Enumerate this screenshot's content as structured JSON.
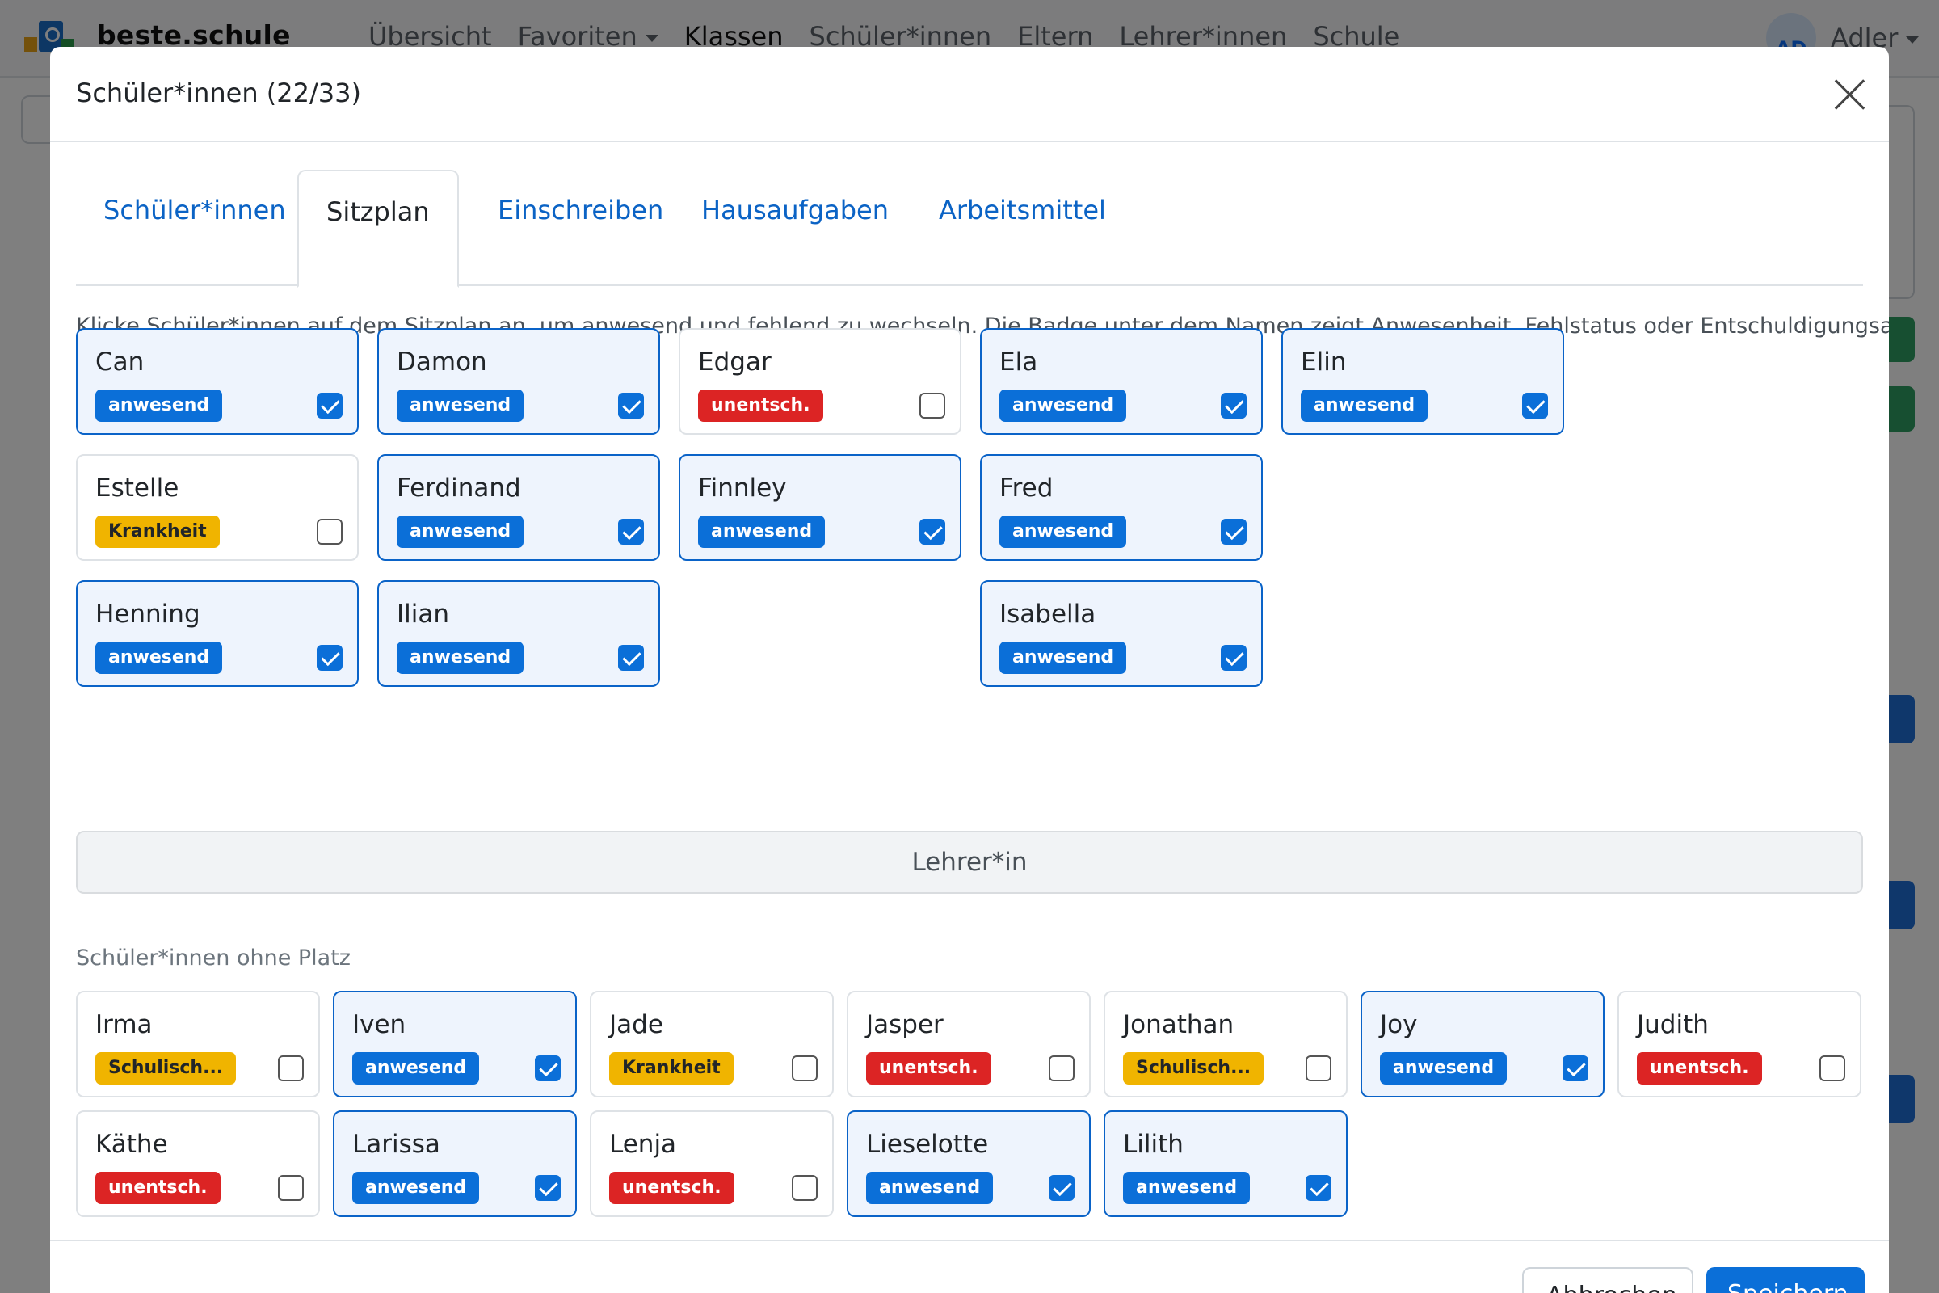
{
  "navbar": {
    "brand": "beste.schule",
    "links": [
      "Übersicht",
      "Favoriten",
      "Klassen",
      "Schüler*innen",
      "Eltern",
      "Lehrer*innen",
      "Schule"
    ],
    "user_initials": "AD",
    "user_name": "Adler"
  },
  "modal": {
    "title": "Schüler*innen (22/33)",
    "tabs": [
      "Schüler*innen",
      "Sitzplan",
      "Einschreiben",
      "Hausaufgaben",
      "Arbeitsmittel"
    ],
    "active_tab": "Sitzplan",
    "hint": "Klicke Schüler*innen auf dem Sitzplan an, um anwesend und fehlend zu wechseln. Die Badge unter dem Namen zeigt Anwesenheit, Fehlstatus oder Entschuldigungsart.",
    "seated": [
      {
        "name": "Can",
        "badge": "anwesend",
        "status": "present",
        "checked": true
      },
      {
        "name": "Damon",
        "badge": "anwesend",
        "status": "present",
        "checked": true
      },
      {
        "name": "Edgar",
        "badge": "unentsch.",
        "status": "absent",
        "checked": false
      },
      {
        "name": "Ela",
        "badge": "anwesend",
        "status": "present",
        "checked": true
      },
      {
        "name": "Elin",
        "badge": "anwesend",
        "status": "present",
        "checked": true
      },
      {
        "name": "Estelle",
        "badge": "Krankheit",
        "status": "sick",
        "checked": false
      },
      {
        "name": "Ferdinand",
        "badge": "anwesend",
        "status": "present",
        "checked": true
      },
      {
        "name": "Finnley",
        "badge": "anwesend",
        "status": "present",
        "checked": true
      },
      {
        "name": "Fred",
        "badge": "anwesend",
        "status": "present",
        "checked": true
      },
      {
        "name": "Henning",
        "badge": "anwesend",
        "status": "present",
        "checked": true
      },
      {
        "name": "Ilian",
        "badge": "anwesend",
        "status": "present",
        "checked": true
      },
      {
        "name": "Isabella",
        "badge": "anwesend",
        "status": "present",
        "checked": true
      }
    ],
    "teacher_label": "Lehrer*in",
    "unseated_title": "Schüler*innen ohne Platz",
    "unseated": [
      {
        "name": "Irma",
        "badge": "Schulisch...",
        "status": "school",
        "checked": false
      },
      {
        "name": "Iven",
        "badge": "anwesend",
        "status": "present",
        "checked": true
      },
      {
        "name": "Jade",
        "badge": "Krankheit",
        "status": "sick",
        "checked": false
      },
      {
        "name": "Jasper",
        "badge": "unentsch.",
        "status": "absent",
        "checked": false
      },
      {
        "name": "Jonathan",
        "badge": "Schulisch...",
        "status": "school",
        "checked": false
      },
      {
        "name": "Joy",
        "badge": "anwesend",
        "status": "present",
        "checked": true
      },
      {
        "name": "Judith",
        "badge": "unentsch.",
        "status": "absent",
        "checked": false
      },
      {
        "name": "Käthe",
        "badge": "unentsch.",
        "status": "absent",
        "checked": false
      },
      {
        "name": "Larissa",
        "badge": "anwesend",
        "status": "present",
        "checked": true
      },
      {
        "name": "Lenja",
        "badge": "unentsch.",
        "status": "absent",
        "checked": false
      },
      {
        "name": "Lieselotte",
        "badge": "anwesend",
        "status": "present",
        "checked": true
      },
      {
        "name": "Lilith",
        "badge": "anwesend",
        "status": "present",
        "checked": true
      }
    ],
    "footer": {
      "cancel_label": "Abbrechen",
      "save_label": "Speichern"
    }
  },
  "colors": {
    "primary": "#0b6fd8",
    "danger": "#dc2424",
    "warning": "#f0b400"
  }
}
